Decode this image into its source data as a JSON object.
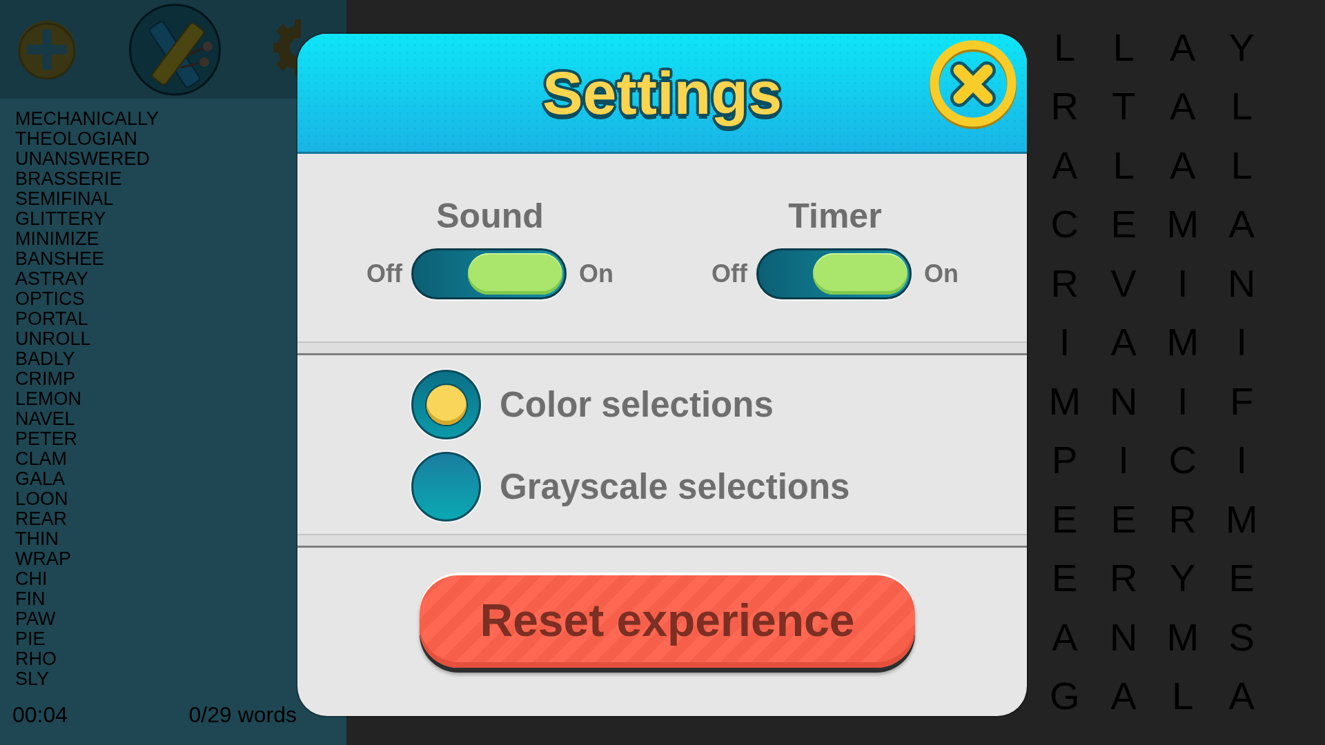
{
  "word_list": [
    "MECHANICALLY",
    "THEOLOGIAN",
    "UNANSWERED",
    "BRASSERIE",
    "SEMIFINAL",
    "GLITTERY",
    "MINIMIZE",
    "BANSHEE",
    "ASTRAY",
    "OPTICS",
    "PORTAL",
    "UNROLL",
    "BADLY",
    "CRIMP",
    "LEMON",
    "NAVEL",
    "PETER",
    "CLAM",
    "GALA",
    "LOON",
    "REAR",
    "THIN",
    "WRAP",
    "CHI",
    "FIN",
    "PAW",
    "PIE",
    "RHO",
    "SLY"
  ],
  "footer": {
    "timer": "00:04",
    "progress": "0/29 words"
  },
  "letter_grid": [
    [
      "L",
      "L",
      "A",
      "Y"
    ],
    [
      "R",
      "T",
      "A",
      "L"
    ],
    [
      "A",
      "L",
      "A",
      "L"
    ],
    [
      "C",
      "E",
      "M",
      "A"
    ],
    [
      "R",
      "V",
      "I",
      "N"
    ],
    [
      "I",
      "A",
      "M",
      "I"
    ],
    [
      "M",
      "N",
      "I",
      "F"
    ],
    [
      "P",
      "I",
      "C",
      "I"
    ],
    [
      "E",
      "E",
      "R",
      "M"
    ],
    [
      "E",
      "R",
      "Y",
      "E"
    ],
    [
      "A",
      "N",
      "M",
      "S"
    ],
    [
      "G",
      "A",
      "L",
      "A"
    ]
  ],
  "settings_dialog": {
    "title": "Settings",
    "toggles": [
      {
        "label": "Sound",
        "off_label": "Off",
        "on_label": "On",
        "on": true
      },
      {
        "label": "Timer",
        "off_label": "Off",
        "on_label": "On",
        "on": true
      }
    ],
    "selection_styles": [
      {
        "label": "Color selections",
        "selected": true
      },
      {
        "label": "Grayscale selections",
        "selected": false
      }
    ],
    "reset_button": "Reset experience"
  }
}
